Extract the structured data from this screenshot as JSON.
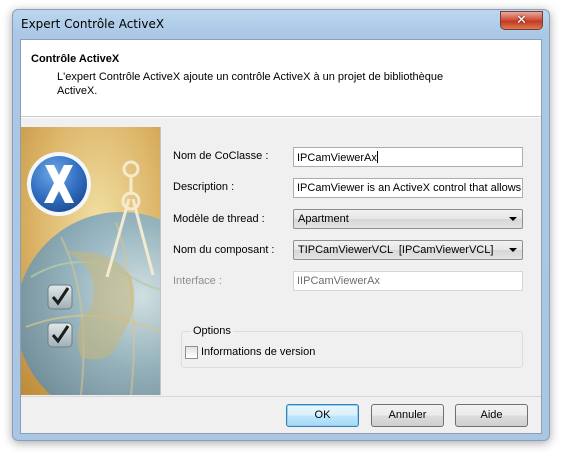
{
  "window": {
    "title": "Expert Contrôle ActiveX",
    "close_glyph": "✕"
  },
  "header": {
    "title": "Contrôle ActiveX",
    "description": "L'expert Contrôle ActiveX ajoute un contrôle ActiveX à un projet de bibliothèque ActiveX."
  },
  "art": {
    "logo_letter": "X",
    "icons": [
      "activex-logo-icon",
      "globe-icon",
      "compass-icon",
      "checkmark-icon"
    ]
  },
  "form": {
    "coclass": {
      "label": "Nom de CoClasse :",
      "value": "IPCamViewerAx"
    },
    "description": {
      "label": "Description :",
      "value": "IPCamViewer is an ActiveX control that allows t"
    },
    "thread_model": {
      "label": "Modèle de thread :",
      "value": "Apartment"
    },
    "component": {
      "label": "Nom du composant :",
      "value": "TIPCamViewerVCL  [IPCamViewerVCL]"
    },
    "interface": {
      "label": "Interface :",
      "value": "IIPCamViewerAx"
    },
    "options": {
      "title": "Options",
      "version_info_label": "Informations de version",
      "version_info_checked": false
    }
  },
  "buttons": {
    "ok": "OK",
    "cancel": "Annuler",
    "help": "Aide"
  },
  "colors": {
    "accent": "#3c7fb1",
    "frame": "#aac8e6",
    "art_background": "#d9b46a"
  }
}
